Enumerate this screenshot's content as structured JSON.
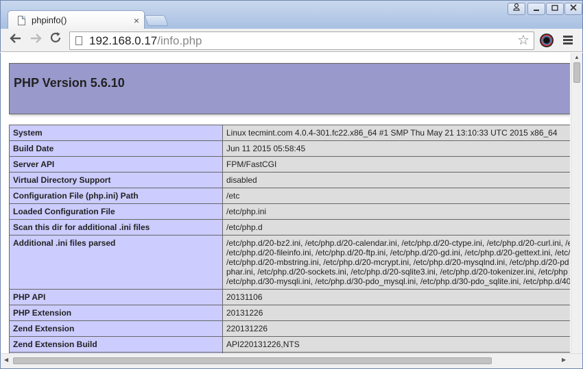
{
  "browser": {
    "tab_title": "phpinfo()",
    "tab_close": "×",
    "url_host": "192.168.0.17",
    "url_path": "/info.php"
  },
  "php": {
    "version_title": "PHP Version 5.6.10"
  },
  "info_rows": [
    {
      "key": "System",
      "value": "Linux tecmint.com 4.0.4-301.fc22.x86_64 #1 SMP Thu May 21 13:10:33 UTC 2015 x86_64"
    },
    {
      "key": "Build Date",
      "value": "Jun 11 2015 05:58:45"
    },
    {
      "key": "Server API",
      "value": "FPM/FastCGI"
    },
    {
      "key": "Virtual Directory Support",
      "value": "disabled"
    },
    {
      "key": "Configuration File (php.ini) Path",
      "value": "/etc"
    },
    {
      "key": "Loaded Configuration File",
      "value": "/etc/php.ini"
    },
    {
      "key": "Scan this dir for additional .ini files",
      "value": "/etc/php.d"
    },
    {
      "key": "Additional .ini files parsed",
      "lines": [
        "/etc/php.d/20-bz2.ini, /etc/php.d/20-calendar.ini, /etc/php.d/20-ctype.ini, /etc/php.d/20-curl.ini, /e",
        "/etc/php.d/20-fileinfo.ini, /etc/php.d/20-ftp.ini, /etc/php.d/20-gd.ini, /etc/php.d/20-gettext.ini, /etc/",
        "/etc/php.d/20-mbstring.ini, /etc/php.d/20-mcrypt.ini, /etc/php.d/20-mysqlnd.ini, /etc/php.d/20-pd",
        "phar.ini, /etc/php.d/20-sockets.ini, /etc/php.d/20-sqlite3.ini, /etc/php.d/20-tokenizer.ini, /etc/php",
        "/etc/php.d/30-mysqli.ini, /etc/php.d/30-pdo_mysql.ini, /etc/php.d/30-pdo_sqlite.ini, /etc/php.d/40"
      ]
    },
    {
      "key": "PHP API",
      "value": "20131106"
    },
    {
      "key": "PHP Extension",
      "value": "20131226"
    },
    {
      "key": "Zend Extension",
      "value": "220131226"
    },
    {
      "key": "Zend Extension Build",
      "value": "API220131226,NTS"
    },
    {
      "key": "",
      "value": ""
    }
  ]
}
